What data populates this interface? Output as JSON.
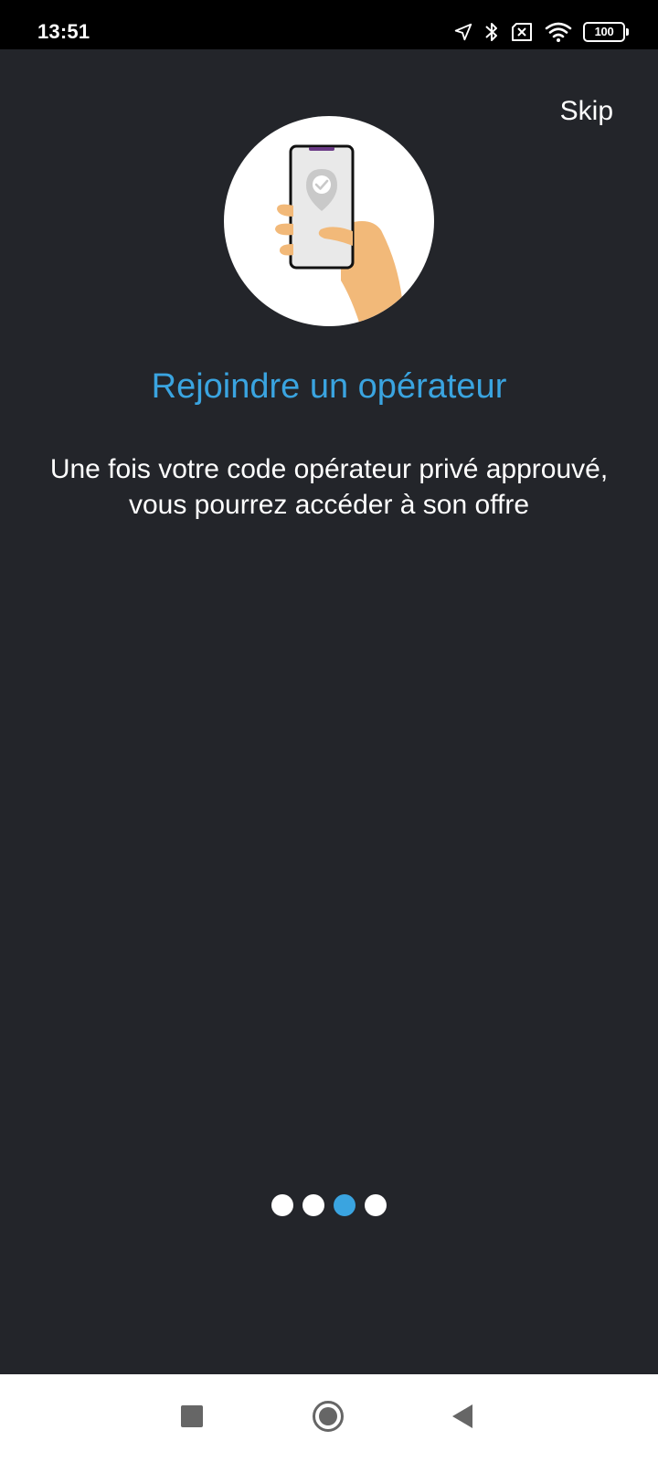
{
  "status_bar": {
    "time": "13:51",
    "icons": [
      "location-arrow-icon",
      "bluetooth-icon",
      "no-sim-icon",
      "wifi-icon",
      "battery-icon"
    ],
    "battery_level": "100"
  },
  "onboarding": {
    "skip_label": "Skip",
    "illustration": "hand-holding-phone-with-check-pin",
    "title": "Rejoindre un opérateur",
    "description": "Une fois votre code opérateur privé approuvé, vous pourrez accéder à son offre",
    "page_count": 4,
    "current_page": 3
  },
  "nav_bar": {
    "buttons": [
      "recents-square-icon",
      "home-circle-icon",
      "back-triangle-icon"
    ]
  },
  "colors": {
    "background": "#23252a",
    "accent": "#3aa4e0",
    "text": "#ffffff"
  }
}
